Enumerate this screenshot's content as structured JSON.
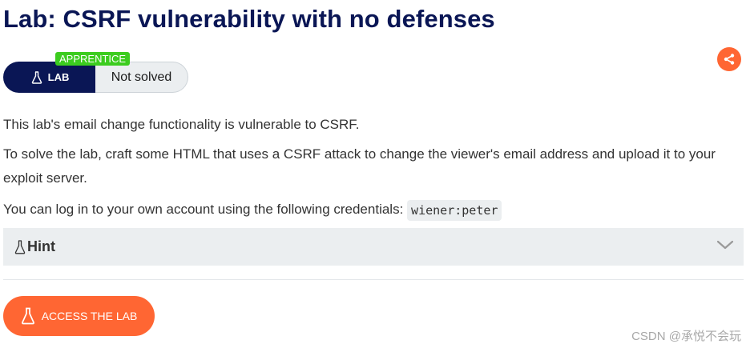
{
  "title": "Lab: CSRF vulnerability with no defenses",
  "badge": {
    "level": "APPRENTICE",
    "lab_label": "LAB",
    "status": "Not solved"
  },
  "description": {
    "p1": "This lab's email change functionality is vulnerable to CSRF.",
    "p2": "To solve the lab, craft some HTML that uses a CSRF attack to change the viewer's email address and upload it to your exploit server.",
    "p3": "You can log in to your own account using the following credentials:",
    "credentials": "wiener:peter"
  },
  "hint": {
    "label": "Hint"
  },
  "access_button": {
    "label": "ACCESS THE LAB"
  },
  "watermark": "CSDN @承悦不会玩",
  "colors": {
    "title": "#0a1655",
    "lab_badge_bg": "#0a1655",
    "level_tag": "#3ccc1f",
    "accent_orange": "#ff6633",
    "hint_bg": "#ebeef0"
  },
  "icons": {
    "share": "share-icon",
    "flask": "flask-icon",
    "chevron": "chevron-down-icon"
  }
}
